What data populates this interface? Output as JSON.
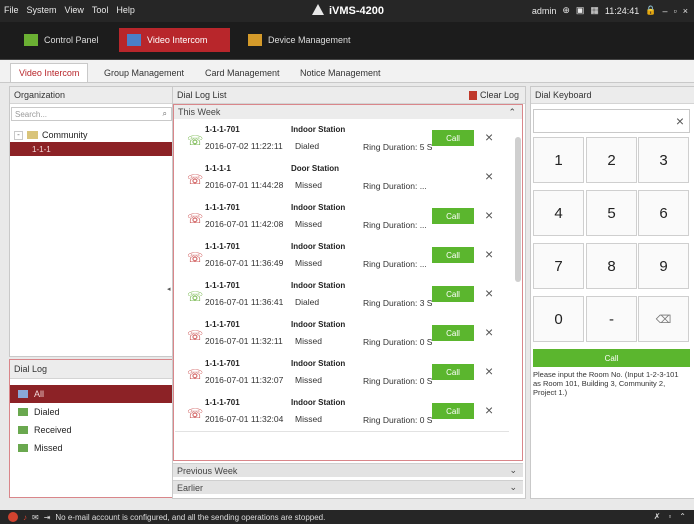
{
  "menu": {
    "items": [
      "File",
      "System",
      "View",
      "Tool",
      "Help"
    ]
  },
  "app": {
    "title": "iVMS-4200"
  },
  "topright": {
    "user": "admin",
    "time": "11:24:41"
  },
  "maintabs": [
    "Control Panel",
    "Video Intercom",
    "Device Management"
  ],
  "subtabs": [
    "Video Intercom",
    "Group Management",
    "Card Management",
    "Notice Management"
  ],
  "organization": {
    "header": "Organization",
    "search_placeholder": "Search...",
    "root": "Community",
    "child": "1-1-1"
  },
  "dial_log_filter": {
    "header": "Dial Log",
    "items": [
      "All",
      "Dialed",
      "Received",
      "Missed"
    ]
  },
  "dial_log_list": {
    "header": "Dial Log List",
    "clear_label": "Clear Log",
    "section_this_week": "This Week",
    "section_previous_week": "Previous Week",
    "section_earlier": "Earlier",
    "call_label": "Call",
    "rows": [
      {
        "room": "1-1-1-701",
        "station": "Indoor Station",
        "datetime": "2016-07-02 11:22:11",
        "type": "Dialed",
        "ring": "Ring Duration: 5 S",
        "status": "ok",
        "has_call": true
      },
      {
        "room": "1-1-1-1",
        "station": "Door Station",
        "datetime": "2016-07-01 11:44:28",
        "type": "Missed",
        "ring": "Ring Duration: ...",
        "status": "miss",
        "has_call": false
      },
      {
        "room": "1-1-1-701",
        "station": "Indoor Station",
        "datetime": "2016-07-01 11:42:08",
        "type": "Missed",
        "ring": "Ring Duration: ...",
        "status": "miss",
        "has_call": true
      },
      {
        "room": "1-1-1-701",
        "station": "Indoor Station",
        "datetime": "2016-07-01 11:36:49",
        "type": "Missed",
        "ring": "Ring Duration: ...",
        "status": "miss",
        "has_call": true
      },
      {
        "room": "1-1-1-701",
        "station": "Indoor Station",
        "datetime": "2016-07-01 11:36:41",
        "type": "Dialed",
        "ring": "Ring Duration: 3 S",
        "status": "ok",
        "has_call": true
      },
      {
        "room": "1-1-1-701",
        "station": "Indoor Station",
        "datetime": "2016-07-01 11:32:11",
        "type": "Missed",
        "ring": "Ring Duration: 0 S",
        "status": "miss",
        "has_call": true
      },
      {
        "room": "1-1-1-701",
        "station": "Indoor Station",
        "datetime": "2016-07-01 11:32:07",
        "type": "Missed",
        "ring": "Ring Duration: 0 S",
        "status": "miss",
        "has_call": true
      },
      {
        "room": "1-1-1-701",
        "station": "Indoor Station",
        "datetime": "2016-07-01 11:32:04",
        "type": "Missed",
        "ring": "Ring Duration: 0 S",
        "status": "miss",
        "has_call": true
      }
    ]
  },
  "dial_keyboard": {
    "header": "Dial Keyboard",
    "keys": [
      "1",
      "2",
      "3",
      "4",
      "5",
      "6",
      "7",
      "8",
      "9",
      "0",
      "-"
    ],
    "call_label": "Call",
    "hint": "Please input the Room No. (Input 1-2-3-101 as Room 101, Building 3, Community 2, Project 1.)"
  },
  "status": {
    "message": "No e-mail account is configured, and all the sending operations are stopped."
  },
  "colors": {
    "accent": "#b8262b",
    "call_green": "#5bb62e",
    "dark_bar": "#262626"
  }
}
